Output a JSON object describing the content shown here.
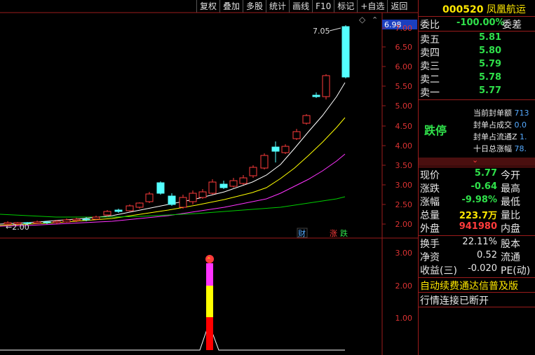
{
  "toolbar": {
    "items": [
      "复权",
      "叠加",
      "多股",
      "统计",
      "画线",
      "F10",
      "标记",
      "+自选",
      "返回"
    ]
  },
  "chart": {
    "price_ticks": [
      "7.00",
      "6.50",
      "6.00",
      "5.50",
      "5.00",
      "4.50",
      "4.00",
      "3.50",
      "3.00",
      "2.50",
      "2.00"
    ],
    "current_price_tag": "6.98",
    "high_label": "7.05",
    "low_label": "2.00",
    "marker_cai": "财",
    "marker_zhang": "涨",
    "marker_die": "跌",
    "indicator_ticks": [
      "3.00",
      "2.00",
      "1.00"
    ]
  },
  "quote": {
    "code": "000520",
    "name": "凤凰航运",
    "weibi_label": "委比",
    "weibi_value": "-100.00%",
    "weicha_label": "委差",
    "asks": [
      {
        "label": "卖五",
        "price": "5.81"
      },
      {
        "label": "卖四",
        "price": "5.80"
      },
      {
        "label": "卖三",
        "price": "5.79"
      },
      {
        "label": "卖二",
        "price": "5.78"
      },
      {
        "label": "卖一",
        "price": "5.77"
      }
    ],
    "limit_status": "跌停",
    "limit_info": [
      {
        "label": "当前封单额",
        "value": "713"
      },
      {
        "label": "封单占成交",
        "value": "0.0"
      },
      {
        "label": "封单占流通Z",
        "value": "1."
      },
      {
        "label": "十日总涨幅",
        "value": "78."
      }
    ],
    "stats": [
      {
        "l1": "现价",
        "v1": "5.77",
        "l2": "今开"
      },
      {
        "l1": "涨跌",
        "v1": "-0.64",
        "l2": "最高"
      },
      {
        "l1": "涨幅",
        "v1": "-9.98%",
        "l2": "最低"
      },
      {
        "l1": "总量",
        "v1": "223.7万",
        "l2": "量比"
      },
      {
        "l1": "外盘",
        "v1": "941980",
        "l2": "内盘"
      }
    ],
    "fund": [
      {
        "l1": "换手",
        "v1": "22.11%",
        "l2": "股本"
      },
      {
        "l1": "净资",
        "v1": "0.52",
        "l2": "流通"
      },
      {
        "l1": "收益(三)",
        "v1": "-0.020",
        "l2": "PE(动)"
      }
    ],
    "notice1": "自动续费通达信普及版",
    "notice2": "行情连接已断开"
  },
  "colors": {
    "up": "#ff3b3b",
    "down": "#54ffff",
    "ma1": "#ffffff",
    "ma2": "#ffff00",
    "ma3": "#ff33ff",
    "ma4": "#00cc00",
    "border": "#9b1b1b"
  }
}
